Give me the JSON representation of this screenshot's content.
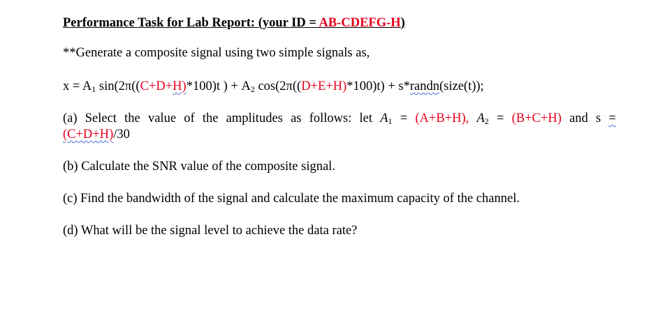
{
  "title": {
    "prefix": "Performance Task for Lab Report: (your ID = ",
    "id": "AB-CDEFG-H",
    "suffix": ")"
  },
  "intro": "**Generate a composite signal using two simple signals as,",
  "formula": {
    "p1": "x = A",
    "sub1": "1",
    "p2": " sin(2π((",
    "r1": "C+D+",
    "r2": "H)",
    "p3": "*100)t ) + A",
    "sub2": "2",
    "p4": " cos(2π((",
    "r3": "D+E+H)",
    "p5": "*100)t) + s*",
    "p6": "randn",
    "p7": "(size(t));"
  },
  "part_a": {
    "w1": "(a)",
    "w2": "Select",
    "w3": "the",
    "w4": "value",
    "w5": "of",
    "w6": "the",
    "w7": "amplitudes",
    "w8": "as",
    "w9": "follows:",
    "w10": "let",
    "a1": "A",
    "a1sub": "1",
    "eq1": "=",
    "v1": "(A+B+H),",
    "a2": "A",
    "a2sub": "2",
    "eq2": "=",
    "v2": "(B+C+H)",
    "and": "and",
    "s": "s",
    "eq3": "=",
    "line2_red": "(C+D+H)",
    "line2_rest": "/30"
  },
  "part_b": "(b) Calculate the SNR value of the composite signal.",
  "part_c": "(c) Find the bandwidth of the signal and calculate the maximum capacity of the channel.",
  "part_d": "(d) What will be the signal level to achieve the data rate?",
  "colors": {
    "text": "#000000",
    "highlight": "#e8001c",
    "spellcheck": "#4a6fd1"
  }
}
